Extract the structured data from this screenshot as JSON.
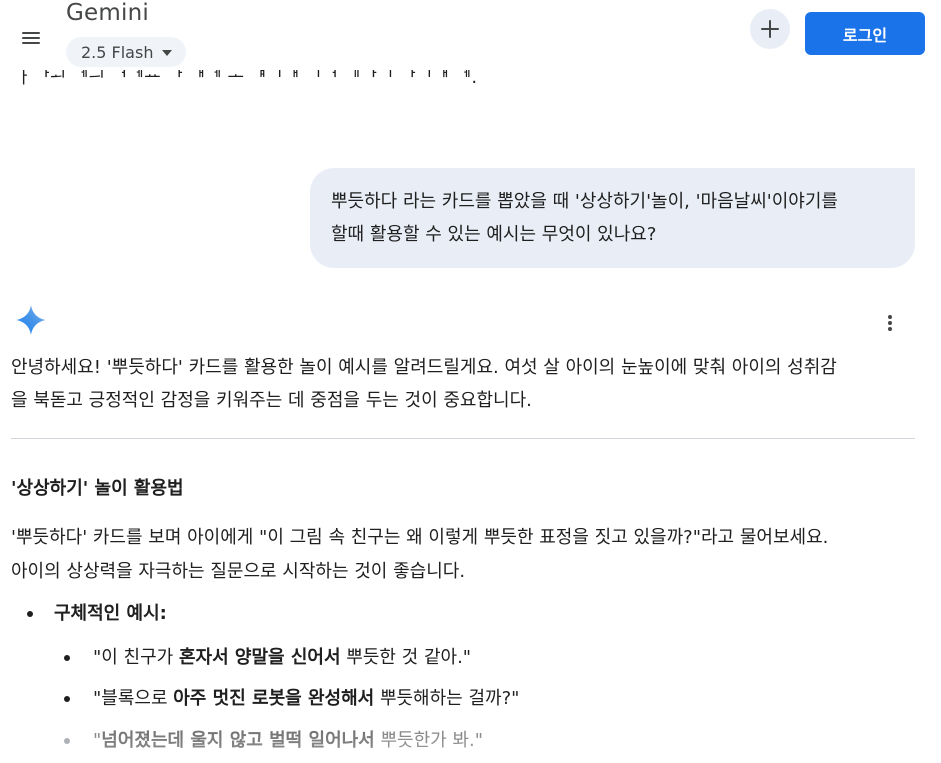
{
  "header": {
    "app_title": "Gemini",
    "model": "2.5 Flash",
    "login_label": "로그인",
    "icons": {
      "menu": "hamburger-menu-icon",
      "dropdown": "caret-down-icon",
      "new_chat": "plus-icon"
    }
  },
  "clipped_text": "ᅟᅡ ᅡᅬ ᅦᅴ ᅥᅦᅭ ᅡ ᅢᅦ ᅩ ᅤᅵᅢ ᅵᅥ ᅵᅵᅡᅵ ᅡᅵᅢ ᅦ.",
  "user_message": {
    "line1": "뿌듯하다 라는 카드를 뽑았을 때 '상상하기'놀이, '마음날씨'이야기를",
    "line2": "할때 활용할 수 있는 예시는 무엇이 있나요?"
  },
  "response": {
    "intro_line1": "안녕하세요! '뿌듯하다' 카드를 활용한 놀이 예시를 알려드릴게요. 여섯 살 아이의 눈높이에 맞춰 아이의 성취감",
    "intro_line2": "을 북돋고 긍정적인 감정을 키워주는 데 중점을 두는 것이 중요합니다.",
    "section_heading": "'상상하기' 놀이 활용법",
    "section_line1": "'뿌듯하다' 카드를 보며 아이에게 \"이 그림 속 친구는 왜 이렇게 뿌듯한 표정을 짓고 있을까?\"라고 물어보세요.",
    "section_line2": "아이의 상상력을 자극하는 질문으로 시작하는 것이 좋습니다.",
    "bullet_title": "구체적인 예시:",
    "examples": [
      {
        "pre": "\"이 친구가 ",
        "bold": "혼자서 양말을 신어서",
        "post": " 뿌듯한 것 같아.\""
      },
      {
        "pre": "\"블록으로 ",
        "bold": "아주 멋진 로봇을 완성해서",
        "post": " 뿌듯해하는 걸까?\""
      },
      {
        "pre": "\"",
        "bold": "넘어졌는데 울지 않고 벌떡 일어나서",
        "post": " 뿌듯한가 봐.\""
      }
    ],
    "icons": {
      "avatar": "gemini-spark-icon",
      "more": "more-vert-icon"
    }
  },
  "colors": {
    "accent": "#1a73e8",
    "bubble": "#e9eef6",
    "pill": "#f0f4f9"
  }
}
